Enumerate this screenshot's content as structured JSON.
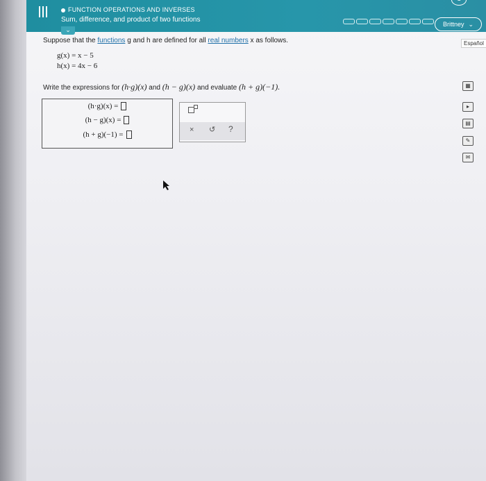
{
  "header": {
    "section_title": "FUNCTION OPERATIONS AND INVERSES",
    "topic_title": "Sum, difference, and product of two functions",
    "user_button_label": "Brittney",
    "language_label": "Español"
  },
  "problem": {
    "intro_prefix": "Suppose that the ",
    "link_functions": "functions",
    "intro_mid": " g and h are defined for all ",
    "link_real_numbers": "real numbers",
    "intro_suffix": " x as follows.",
    "definitions": [
      "g(x) = x − 5",
      "h(x) = 4x − 6"
    ],
    "instruction_prefix": "Write the expressions for ",
    "expr1": "(h·g)(x)",
    "instruction_and": " and ",
    "expr2": "(h − g)(x)",
    "instruction_eval": " and evaluate ",
    "expr3": "(h + g)(−1).",
    "answers": [
      {
        "label": "(h·g)(x) ="
      },
      {
        "label": "(h − g)(x) ="
      },
      {
        "label": "(h + g)(−1) ="
      }
    ]
  },
  "toolbar": {
    "clear_symbol": "×",
    "undo_symbol": "↺",
    "help_symbol": "?"
  },
  "icons": [
    "menu-icon",
    "chevron-down-icon",
    "calculator-icon",
    "video-icon",
    "book-icon",
    "pencil-icon",
    "mail-icon",
    "cursor-icon"
  ]
}
